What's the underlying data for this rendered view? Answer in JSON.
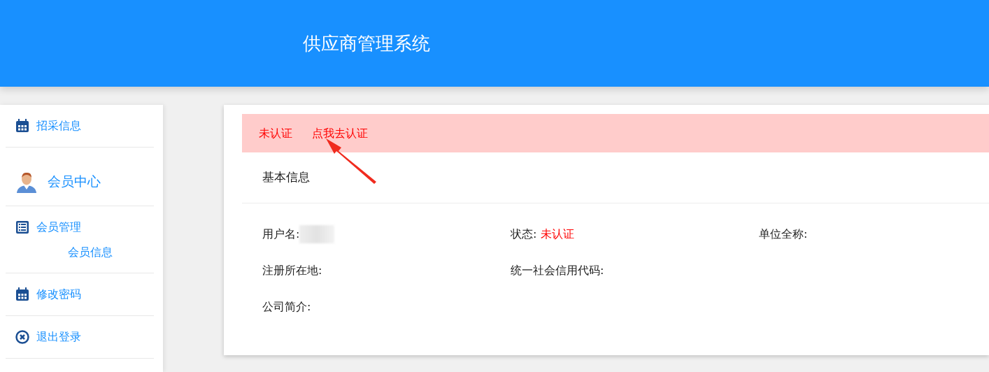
{
  "header": {
    "title": "供应商管理系统"
  },
  "sidebar": {
    "items": [
      {
        "kind": "calendar",
        "label": "招采信息"
      },
      {
        "kind": "person",
        "label": "会员中心"
      },
      {
        "kind": "list",
        "label": "会员管理",
        "children": [
          {
            "label": "会员信息"
          }
        ]
      },
      {
        "kind": "calendar",
        "label": "修改密码"
      },
      {
        "kind": "exit",
        "label": "退出登录"
      }
    ]
  },
  "alert": {
    "status": "未认证",
    "link": "点我去认证"
  },
  "section": {
    "title": "基本信息"
  },
  "field_rows": [
    {
      "fields": [
        {
          "label": "用户名:",
          "redacted": true
        },
        {
          "label": "状态:",
          "value": "未认证",
          "warning": true
        },
        {
          "label": "单位全称:"
        }
      ]
    },
    {
      "fields": [
        {
          "label": "注册所在地:"
        },
        {
          "label": "统一社会信用代码:"
        }
      ]
    },
    {
      "fields": [
        {
          "label": "公司简介:"
        }
      ]
    }
  ]
}
